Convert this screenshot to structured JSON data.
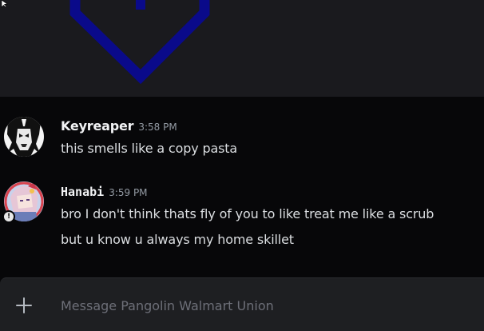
{
  "channel": {
    "input_placeholder": "Message Pangolin Walmart Union"
  },
  "messages": [
    {
      "username": "Keyreaper",
      "timestamp": "3:58 PM",
      "lines": [
        "this smells like a copy pasta"
      ]
    },
    {
      "username": "Hanabi",
      "timestamp": "3:59 PM",
      "lines": [
        "bro I don't think thats fly of you to like treat me like a scrub",
        "but u know u always my home skillet"
      ]
    }
  ],
  "icons": {
    "composer_add": "plus-icon",
    "embed": "shield-chevron-icon",
    "cursor": "mouse-cursor-icon"
  },
  "colors": {
    "background": "#070709",
    "embed_background": "#1a1a1e",
    "embed_shape": "#0a0a8a",
    "username": "#f2f3f5",
    "timestamp": "#949ba4",
    "message_text": "#dbdee1",
    "composer_background": "#1e1f22",
    "placeholder": "#6d6f78"
  }
}
